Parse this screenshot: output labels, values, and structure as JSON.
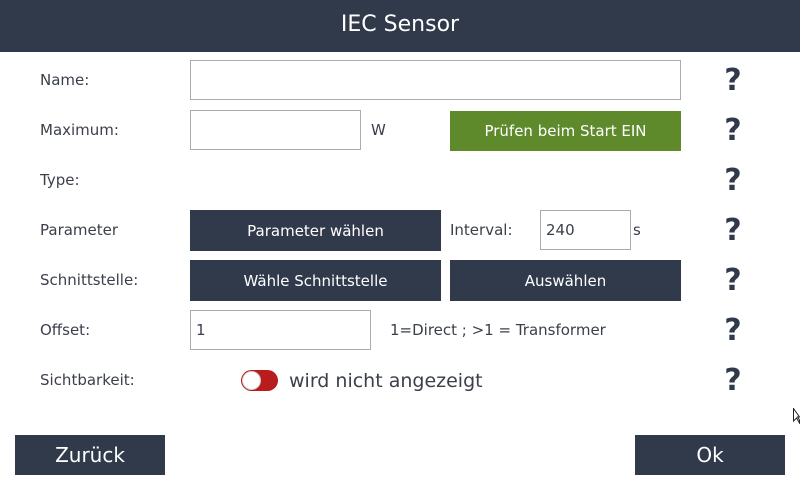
{
  "window": {
    "title": "IEC Sensor"
  },
  "form": {
    "name": {
      "label": "Name:",
      "value": ""
    },
    "maximum": {
      "label": "Maximum:",
      "value": "",
      "unit": "W",
      "check_button": "Prüfen beim Start EIN"
    },
    "type": {
      "label": "Type:"
    },
    "parameter": {
      "label": "Parameter",
      "button": "Parameter wählen",
      "interval_label": "Interval:",
      "interval_value": "240",
      "interval_unit": "s"
    },
    "interface": {
      "label": "Schnittstelle:",
      "choose_button": "Wähle Schnittstelle",
      "select_button": "Auswählen"
    },
    "offset": {
      "label": "Offset:",
      "value": "1",
      "hint": "1=Direct ; >1 = Transformer"
    },
    "visibility": {
      "label": "Sichtbarkeit:",
      "toggle_on": false,
      "toggle_text": "wird nicht angezeigt"
    }
  },
  "help_symbol": "?",
  "footer": {
    "back_label": "Zurück",
    "ok_label": "Ok"
  },
  "colors": {
    "header": "#313a4b",
    "accent_green": "#5f8a2c",
    "toggle_off": "#b91c1c"
  }
}
